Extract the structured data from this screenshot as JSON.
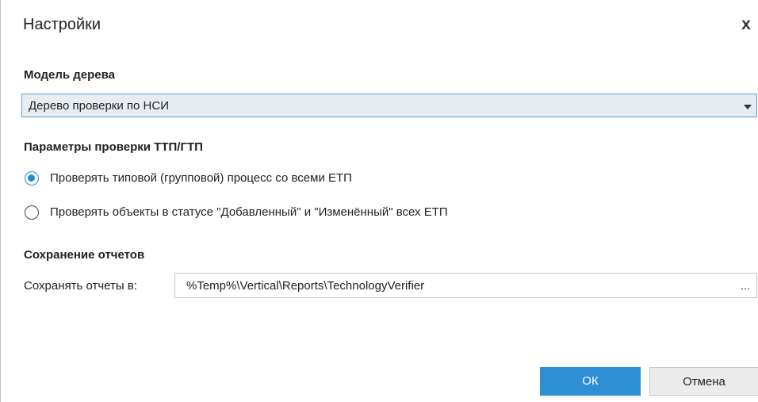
{
  "dialog": {
    "title": "Настройки",
    "close_symbol": "x"
  },
  "tree_model": {
    "label": "Модель дерева",
    "selected": "Дерево проверки по НСИ"
  },
  "check_params": {
    "label": "Параметры проверки ТТП/ГТП",
    "options": [
      {
        "label": "Проверять типовой (групповой) процесс со всеми ЕТП",
        "checked": true
      },
      {
        "label": "Проверять объекты в статусе \"Добавленный\" и \"Изменённый\" всех ЕТП",
        "checked": false
      }
    ]
  },
  "reports": {
    "label": "Сохранение отчетов",
    "path_label": "Сохранять отчеты в:",
    "path_value": "%Temp%\\Vertical\\Reports\\TechnologyVerifier",
    "browse_label": "..."
  },
  "buttons": {
    "ok": "ОК",
    "cancel": "Отмена"
  },
  "colors": {
    "accent": "#2e8fd4",
    "select_border": "#4fa3d9",
    "select_bg": "#e8edf2"
  }
}
